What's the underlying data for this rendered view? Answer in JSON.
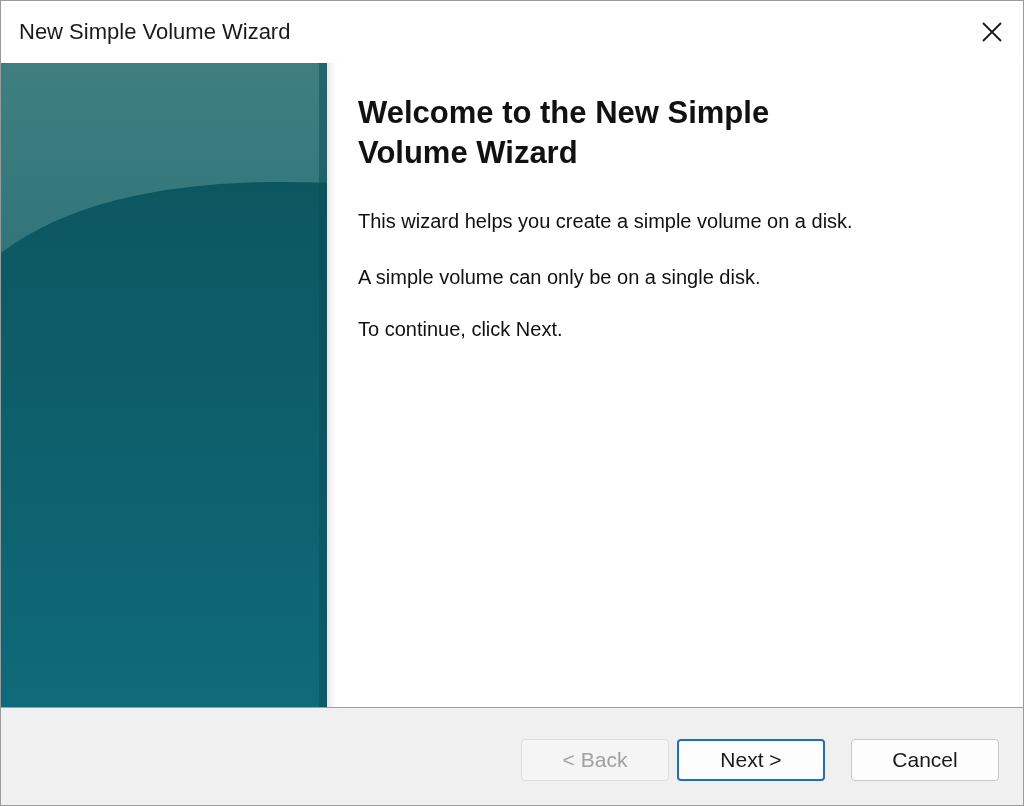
{
  "window": {
    "title": "New Simple Volume Wizard"
  },
  "heading": "Welcome to the New Simple Volume Wizard",
  "paragraphs": [
    "This wizard helps you create a simple volume on a disk.",
    "A simple volume can only be on a single disk.",
    "To continue, click Next."
  ],
  "buttons": [
    {
      "label": "< Back",
      "disabled": true,
      "default": false
    },
    {
      "label": "Next >",
      "disabled": false,
      "default": true
    },
    {
      "label": "Cancel",
      "disabled": false,
      "default": false
    }
  ]
}
